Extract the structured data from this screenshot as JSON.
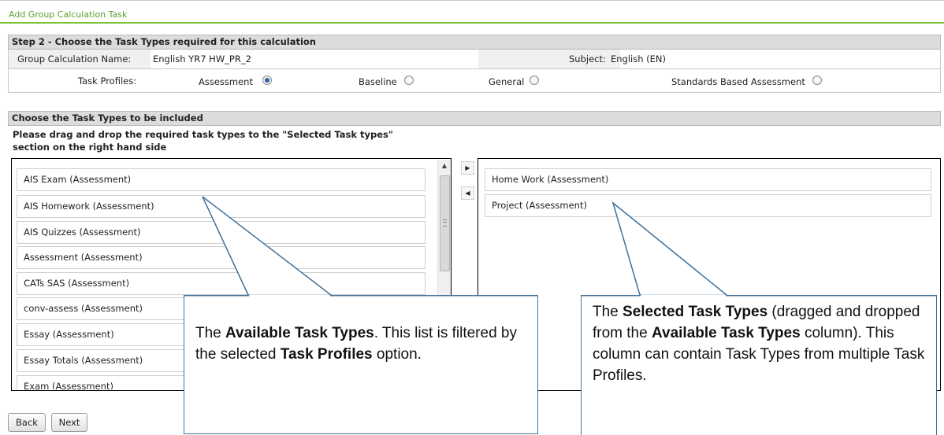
{
  "window": {
    "title": "Add Group Calculation Task"
  },
  "step": {
    "header": "Step 2 - Choose the Task Types required for this calculation",
    "calc_name_label": "Group Calculation Name:",
    "calc_name_value": "English YR7 HW_PR_2",
    "subject_label": "Subject:",
    "subject_value": "English (EN)",
    "profiles_label": "Task Profiles:",
    "profiles": [
      {
        "label": "Assessment",
        "selected": true
      },
      {
        "label": "Baseline",
        "selected": false
      },
      {
        "label": "General",
        "selected": false
      },
      {
        "label": "Standards Based Assessment",
        "selected": false
      }
    ]
  },
  "types": {
    "header": "Choose the Task Types to be included",
    "instruction_line1": "Please drag and drop the required task types to the \"Selected Task types\"",
    "instruction_line2": "section on the right hand side",
    "available": [
      "AIS Exam (Assessment)",
      "AIS Homework (Assessment)",
      "AIS Quizzes (Assessment)",
      "Assessment (Assessment)",
      "CATs SAS (Assessment)",
      "conv-assess (Assessment)",
      "Essay (Assessment)",
      "Essay Totals (Assessment)",
      "Exam (Assessment)"
    ],
    "selected": [
      "Home Work (Assessment)",
      "Project (Assessment)"
    ],
    "move_right_glyph": "▶",
    "move_left_glyph": "◀",
    "scroll_up_glyph": "▲"
  },
  "buttons": {
    "back": "Back",
    "next": "Next"
  },
  "callouts": {
    "left": {
      "t1": "The ",
      "b1": "Available Task Types",
      "t2": ". This list is filtered by the selected ",
      "b2": "Task Profiles",
      "t3": " option."
    },
    "right": {
      "t1": "The ",
      "b1": "Selected Task Types",
      "t2": " (dragged and dropped from the ",
      "b2": "Available Task Types",
      "t3": " column). This column can contain Task Types from multiple Task Profiles."
    }
  },
  "colors": {
    "accent_green": "#7cc33a",
    "callout_border": "#41719c",
    "header_gray": "#dcdcdc",
    "radio_selected": "#2f5fa8"
  }
}
